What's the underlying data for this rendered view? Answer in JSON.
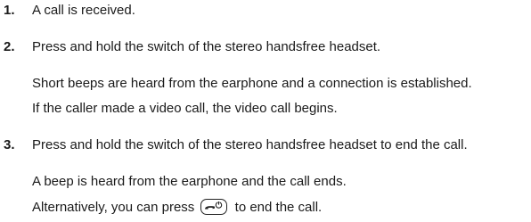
{
  "steps": [
    {
      "number": "1.",
      "lines": [
        "A call is received."
      ]
    },
    {
      "number": "2.",
      "lines": [
        "Press and hold the switch of the stereo handsfree headset.",
        "Short beeps are heard from the earphone and a connection is established.",
        "If the caller made a video call, the video call begins."
      ]
    },
    {
      "number": "3.",
      "lines": [
        "Press and hold the switch of the stereo handsfree headset to end the call.",
        "A beep is heard from the earphone and the call ends."
      ],
      "alt_before": "Alternatively, you can press",
      "alt_after": "to end the call.",
      "key_icon": "end-call-power-key-icon"
    }
  ]
}
